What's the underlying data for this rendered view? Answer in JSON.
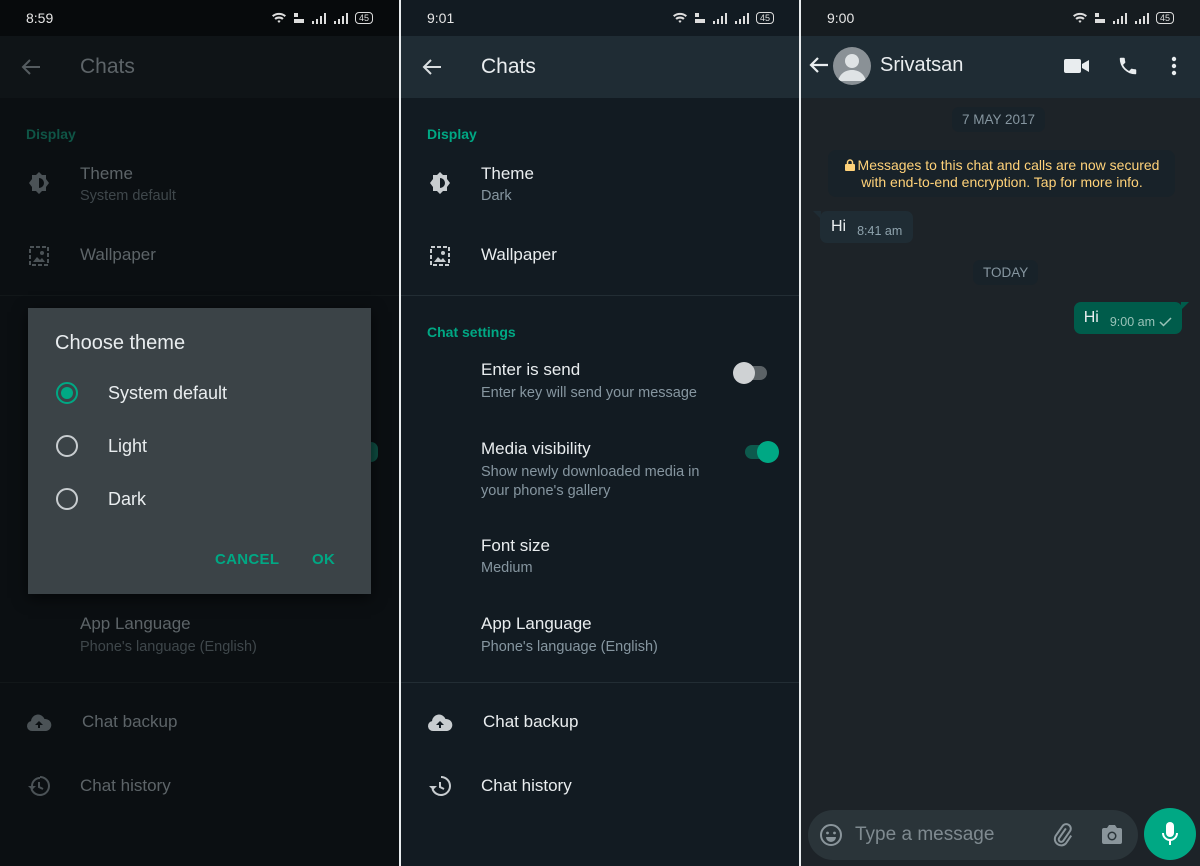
{
  "colors": {
    "accent": "#00a884",
    "outgoing_bubble": "#005c4b",
    "encryption_text": "#ffd279"
  },
  "panel1": {
    "status": {
      "time": "8:59",
      "battery": "45"
    },
    "appbar": {
      "title": "Chats"
    },
    "display_header": "Display",
    "theme": {
      "title": "Theme",
      "value": "System default"
    },
    "wallpaper": {
      "title": "Wallpaper"
    },
    "app_language": {
      "title": "App Language",
      "value": "Phone's language (English)"
    },
    "chat_backup": {
      "title": "Chat backup"
    },
    "chat_history": {
      "title": "Chat history"
    },
    "dialog": {
      "title": "Choose theme",
      "options": [
        {
          "label": "System default",
          "selected": true
        },
        {
          "label": "Light",
          "selected": false
        },
        {
          "label": "Dark",
          "selected": false
        }
      ],
      "cancel_label": "CANCEL",
      "ok_label": "OK"
    }
  },
  "panel2": {
    "status": {
      "time": "9:01",
      "battery": "45"
    },
    "appbar": {
      "title": "Chats"
    },
    "display_header": "Display",
    "theme": {
      "title": "Theme",
      "value": "Dark"
    },
    "wallpaper": {
      "title": "Wallpaper"
    },
    "chat_settings_header": "Chat settings",
    "enter_is_send": {
      "title": "Enter is send",
      "subtitle": "Enter key will send your message",
      "enabled": false
    },
    "media_visibility": {
      "title": "Media visibility",
      "subtitle_line1": "Show newly downloaded media in",
      "subtitle_line2": "your phone's gallery",
      "enabled": true
    },
    "font_size": {
      "title": "Font size",
      "value": "Medium"
    },
    "app_language": {
      "title": "App Language",
      "value": "Phone's language (English)"
    },
    "chat_backup": {
      "title": "Chat backup"
    },
    "chat_history": {
      "title": "Chat history"
    }
  },
  "panel3": {
    "status": {
      "time": "9:00",
      "battery": "45"
    },
    "contact_name": "Srivatsan",
    "date_pill_1": "7 MAY 2017",
    "encryption_line1": "Messages to this chat and calls are now secured",
    "encryption_line2": "with end-to-end encryption. Tap for more info.",
    "messages": [
      {
        "direction": "incoming",
        "text": "Hi",
        "time": "8:41 am"
      },
      {
        "direction": "outgoing",
        "text": "Hi",
        "time": "9:00 am",
        "status": "sent"
      }
    ],
    "date_pill_2": "TODAY",
    "composer_placeholder": "Type a message"
  }
}
